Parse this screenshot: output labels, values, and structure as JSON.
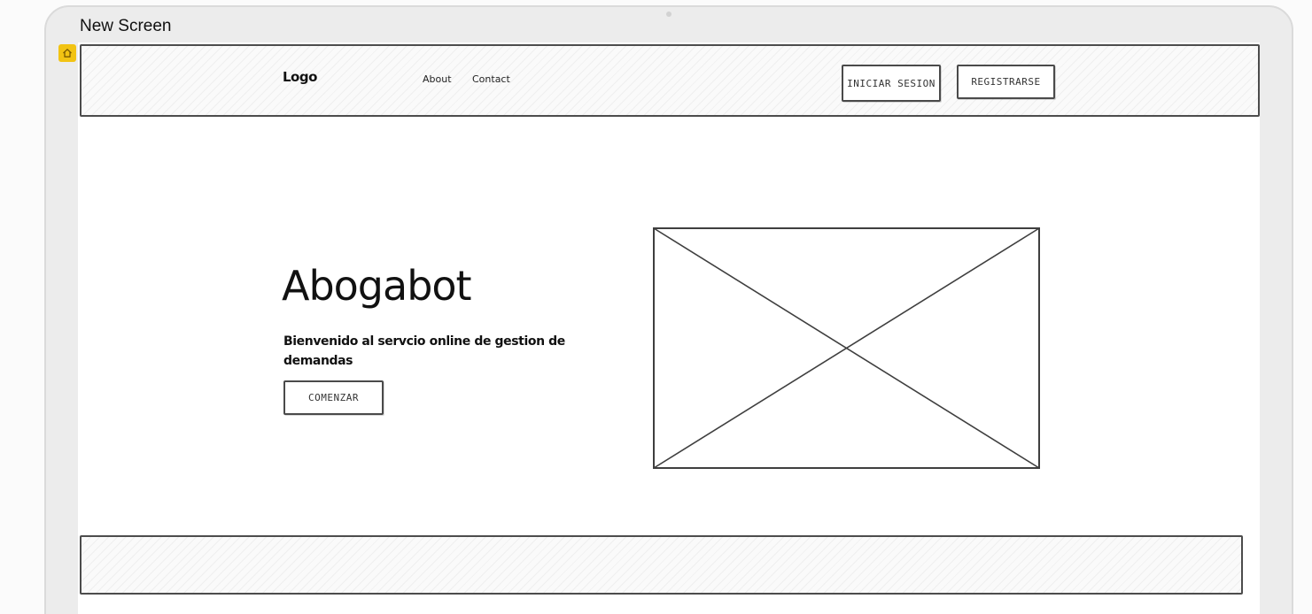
{
  "screen": {
    "title": "New Screen"
  },
  "header": {
    "logo": "Logo",
    "nav": [
      {
        "label": "About"
      },
      {
        "label": "Contact"
      }
    ],
    "login_label": "INICIAR SESION",
    "register_label": "REGISTRARSE"
  },
  "hero": {
    "title": "Abogabot",
    "subtitle": "Bienvenido al servcio online de gestion de demandas",
    "cta_label": "COMENZAR"
  },
  "colors": {
    "frame": "#ececec",
    "badge": "#f2c313",
    "stroke": "#4c4c4c"
  },
  "icons": {
    "badge": "home-icon",
    "placeholder": "image-placeholder-icon"
  }
}
